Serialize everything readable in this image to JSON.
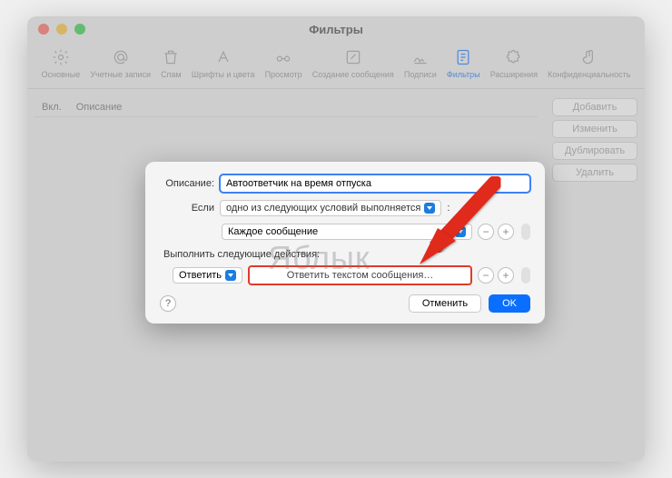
{
  "window": {
    "title": "Фильтры"
  },
  "toolbar": {
    "items": [
      {
        "label": "Основные"
      },
      {
        "label": "Учетные записи"
      },
      {
        "label": "Спам"
      },
      {
        "label": "Шрифты и цвета"
      },
      {
        "label": "Просмотр"
      },
      {
        "label": "Создание сообщения"
      },
      {
        "label": "Подписи"
      },
      {
        "label": "Фильтры"
      },
      {
        "label": "Расширения"
      },
      {
        "label": "Конфиденциальность"
      }
    ]
  },
  "list": {
    "col_enabled": "Вкл.",
    "col_description": "Описание"
  },
  "sidebar": {
    "add": "Добавить",
    "edit": "Изменить",
    "duplicate": "Дублировать",
    "delete": "Удалить"
  },
  "dialog": {
    "description_label": "Описание:",
    "description_value": "Автоответчик на время отпуска",
    "if_label": "Если",
    "if_condition": "одно из следующих условий выполняется",
    "condition_each": "Каждое сообщение",
    "actions_label": "Выполнить следующие действия:",
    "action_type": "Ответить",
    "action_text": "Ответить текстом сообщения…",
    "help": "?",
    "cancel": "Отменить",
    "ok": "OK",
    "minus": "−",
    "plus": "+"
  },
  "watermark": "Яблык"
}
